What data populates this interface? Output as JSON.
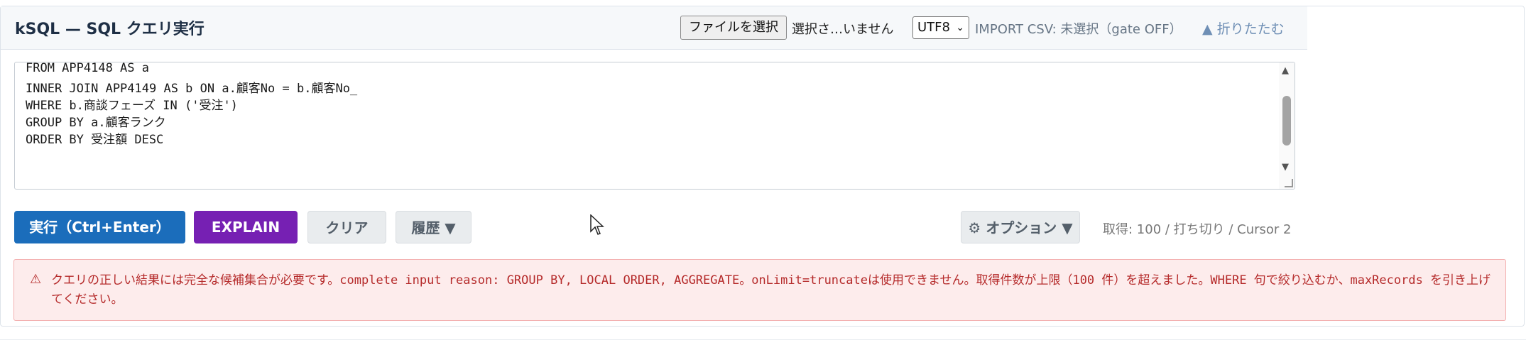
{
  "header": {
    "title": "kSQL — SQL クエリ実行",
    "file_button": "ファイルを選択",
    "file_status": "選択さ…いません",
    "encoding": "UTF8",
    "import_status": "IMPORT CSV: 未選択（gate OFF）",
    "collapse": "▲ 折りたたむ"
  },
  "editor": {
    "lines": [
      "FROM APP4148 AS a",
      "INNER JOIN APP4149 AS b ON a.顧客No = b.顧客No_",
      "WHERE b.商談フェーズ IN ('受注')",
      "GROUP BY a.顧客ランク",
      "ORDER BY 受注額 DESC"
    ]
  },
  "toolbar": {
    "run": "実行（Ctrl+Enter）",
    "explain": "EXPLAIN",
    "clear": "クリア",
    "history": "履歴 ▼",
    "options": "⚙ オプション ▼",
    "fetch_status": "取得: 100 / 打ち切り / Cursor 2"
  },
  "error": {
    "icon": "warning-icon",
    "message": "クエリの正しい結果には完全な候補集合が必要です。complete input reason: GROUP BY, LOCAL ORDER, AGGREGATE。onLimit=truncateは使用できません。取得件数が上限（100 件）を超えました。WHERE 句で絞り込むか、maxRecords を引き上げてください。"
  }
}
